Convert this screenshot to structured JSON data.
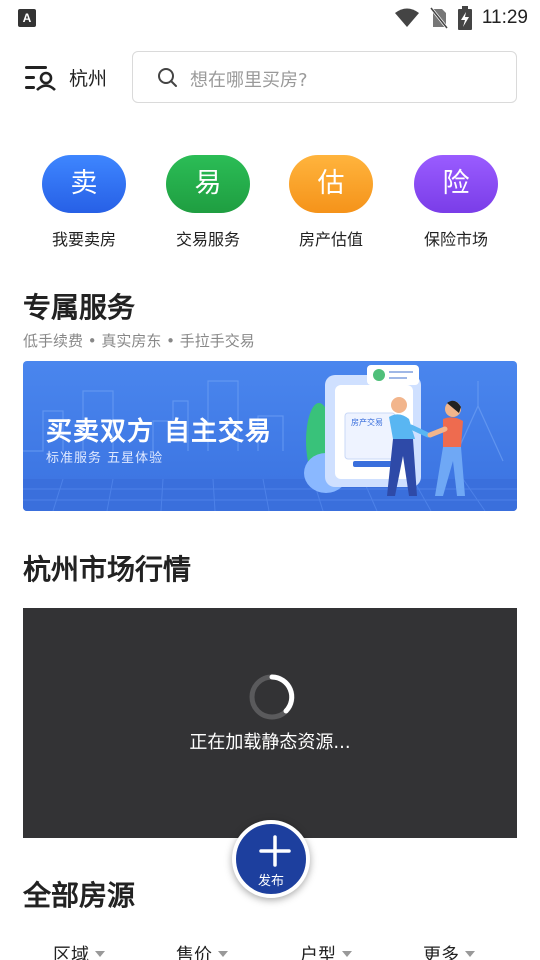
{
  "status_bar": {
    "left_badge": "A",
    "time": "11:29"
  },
  "header": {
    "city": "杭州",
    "search_placeholder": "想在哪里买房?"
  },
  "quick_services": [
    {
      "glyph": "卖",
      "label": "我要卖房",
      "color": "#3470f0"
    },
    {
      "glyph": "易",
      "label": "交易服务",
      "color": "#25ad4c"
    },
    {
      "glyph": "估",
      "label": "房产估值",
      "color": "#f7a12a"
    },
    {
      "glyph": "险",
      "label": "保险市场",
      "color": "#8a4cf5"
    }
  ],
  "exclusive": {
    "title": "专属服务",
    "subtitle": "低手续费 • 真实房东 • 手拉手交易",
    "banner_title": "买卖双方 自主交易",
    "banner_subtitle": "标准服务 五星体验",
    "banner_doc_label": "房产交易"
  },
  "market": {
    "title": "杭州市场行情",
    "loading_text": "正在加载静态资源..."
  },
  "fab": {
    "label": "发布"
  },
  "listings": {
    "title": "全部房源",
    "filters": [
      "区域",
      "售价",
      "户型",
      "更多"
    ]
  }
}
